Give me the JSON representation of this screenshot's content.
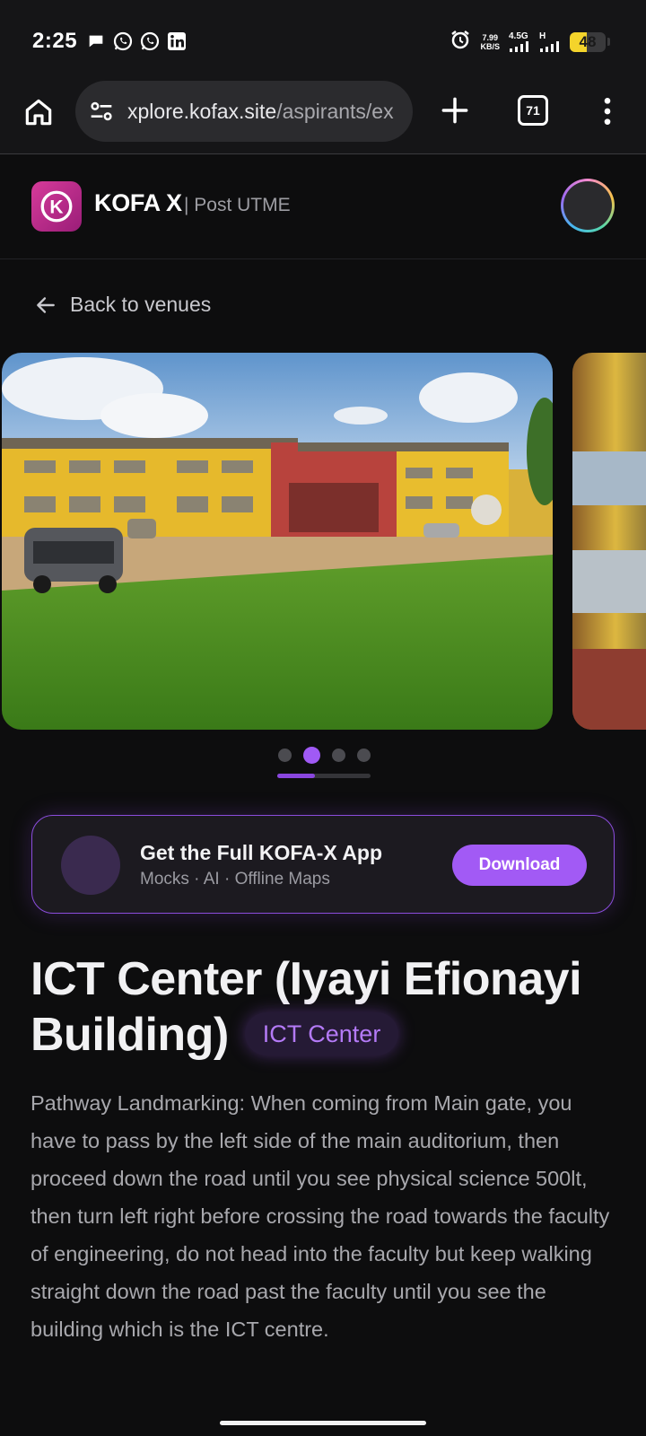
{
  "status_bar": {
    "time": "2:25",
    "notification_icons": [
      "chat-bubble-icon",
      "whatsapp-icon",
      "whatsapp-icon",
      "linkedin-icon"
    ],
    "right_icons": [
      "alarm-icon",
      "signal-4g-icon",
      "signal-h-icon"
    ],
    "data_speed": "7.99",
    "data_speed_unit": "KB/S",
    "network_4g": "4.5G",
    "network_h": "H",
    "battery_level": "48"
  },
  "browser": {
    "url_host": "xplore.kofax.site",
    "url_path": "/aspirants/ex",
    "tab_count": "71"
  },
  "site_header": {
    "brand": "KOFA X",
    "subtitle": "| Post UTME",
    "logo_letter": "K"
  },
  "back_link": {
    "label": "Back to venues"
  },
  "carousel": {
    "slides": 4,
    "active_index": 1,
    "progress": 0.4
  },
  "promo": {
    "title": "Get the Full KOFA-X App",
    "subtitle": "Mocks · AI · Offline Maps",
    "button_label": "Download"
  },
  "venue": {
    "title": "ICT Center (Iyayi Efionayi Building)",
    "badge": "ICT Center",
    "description": "Pathway Landmarking: When coming from Main gate, you have to pass by the left side of the main auditorium, then proceed down the road until you see physical science 500lt, then turn left right before crossing the road towards the faculty of engineering, do not head into the faculty but keep walking straight down the road past the faculty until you see the building which is the ICT centre."
  },
  "colors": {
    "accent": "#a25af5",
    "background": "#0d0d0e",
    "battery": "#f4d42b"
  }
}
